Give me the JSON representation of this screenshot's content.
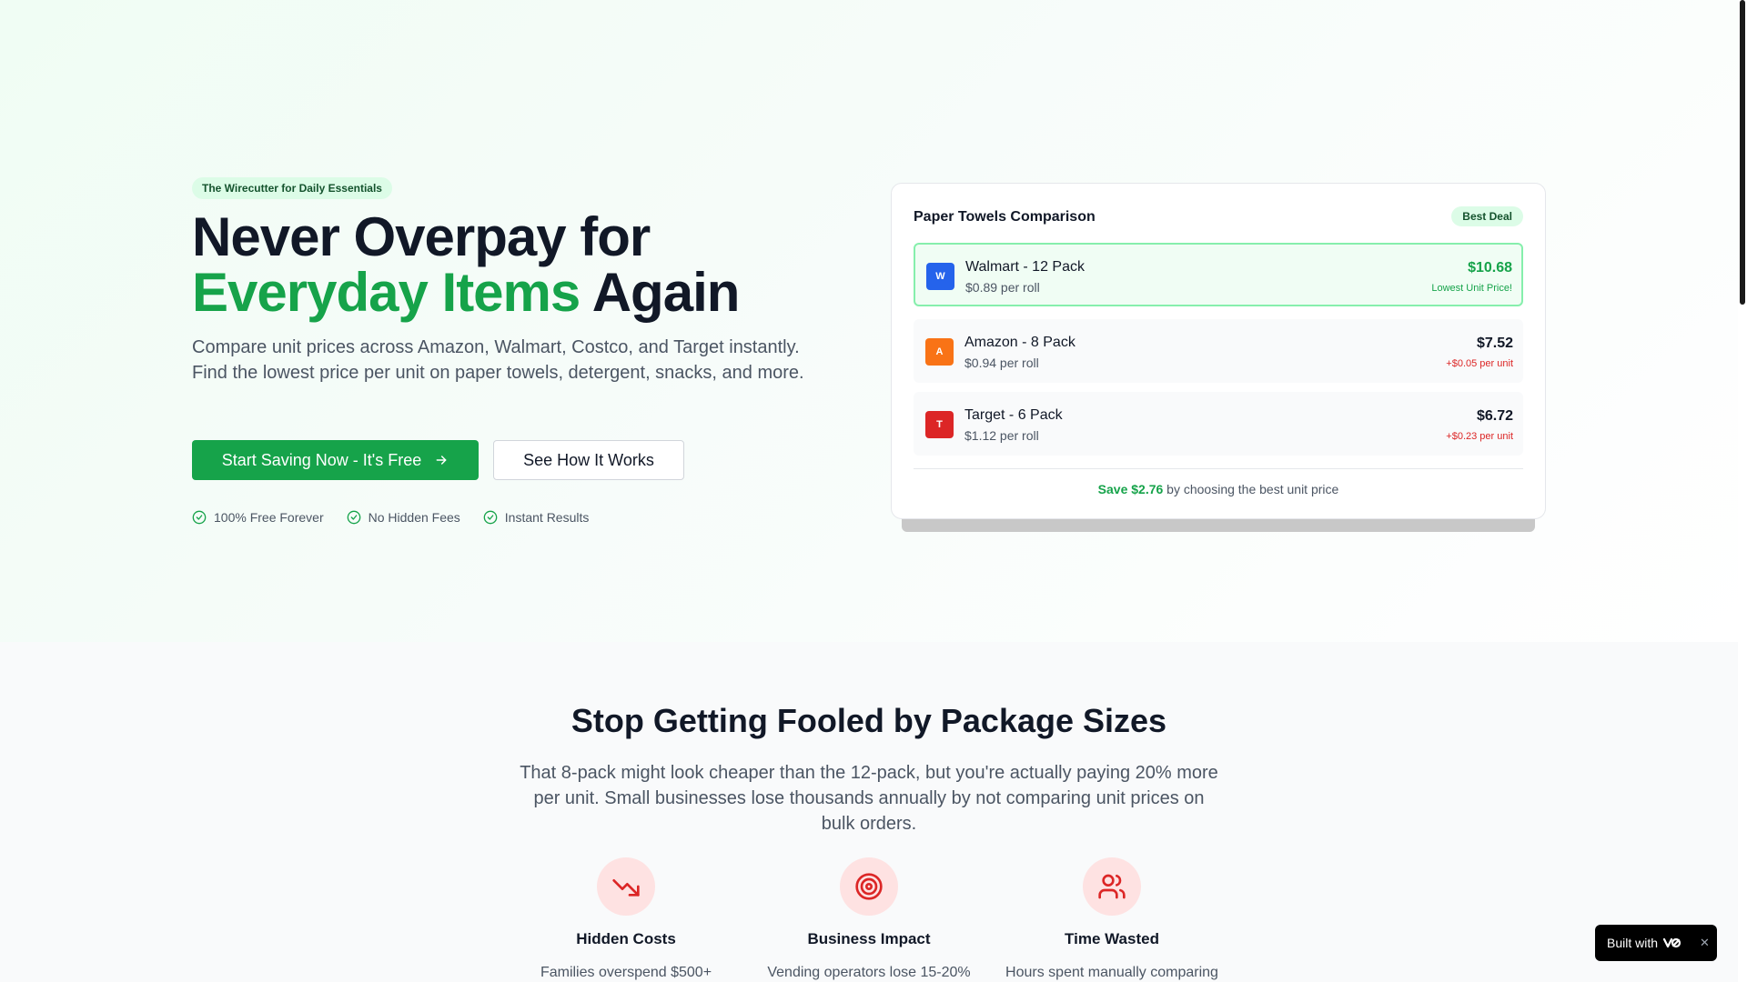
{
  "hero": {
    "badge": "The Wirecutter for Daily Essentials",
    "headline_line1": "Never Overpay for",
    "headline_green": "Everyday Items",
    "headline_tail": " Again",
    "subtext": "Compare unit prices across Amazon, Walmart, Costco, and Target instantly. Find the lowest price per unit on paper towels, detergent, snacks, and more.",
    "primary_button": "Start Saving Now - It's Free",
    "secondary_button": "See How It Works",
    "features": [
      "100% Free Forever",
      "No Hidden Fees",
      "Instant Results"
    ]
  },
  "comparison": {
    "title": "Paper Towels Comparison",
    "badge": "Best Deal",
    "rows": [
      {
        "icon": "W",
        "name": "Walmart - 12 Pack",
        "unit": "$0.89 per roll",
        "price": "$10.68",
        "note": "Lowest Unit Price!",
        "color": "#2563eb"
      },
      {
        "icon": "A",
        "name": "Amazon - 8 Pack",
        "unit": "$0.94 per roll",
        "price": "$7.52",
        "note": "+$0.05 per unit",
        "color": "#f97316"
      },
      {
        "icon": "T",
        "name": "Target - 6 Pack",
        "unit": "$1.12 per roll",
        "price": "$6.72",
        "note": "+$0.23 per unit",
        "color": "#dc2626"
      }
    ],
    "footer_save": "Save $2.76",
    "footer_rest": " by choosing the best unit price"
  },
  "section2": {
    "title": "Stop Getting Fooled by Package Sizes",
    "subtitle": "That 8-pack might look cheaper than the 12-pack, but you're actually paying 20% more per unit. Small businesses lose thousands annually by not comparing unit prices on bulk orders.",
    "cards": [
      {
        "icon": "trending-down-icon",
        "title": "Hidden Costs",
        "desc": "Families overspend $500+"
      },
      {
        "icon": "target-icon",
        "title": "Business Impact",
        "desc": "Vending operators lose 15-20%"
      },
      {
        "icon": "users-icon",
        "title": "Time Wasted",
        "desc": "Hours spent manually comparing"
      }
    ]
  },
  "builtwith": {
    "label": "Built with"
  },
  "colors": {
    "accent": "#16a34a",
    "danger": "#dc2626"
  }
}
